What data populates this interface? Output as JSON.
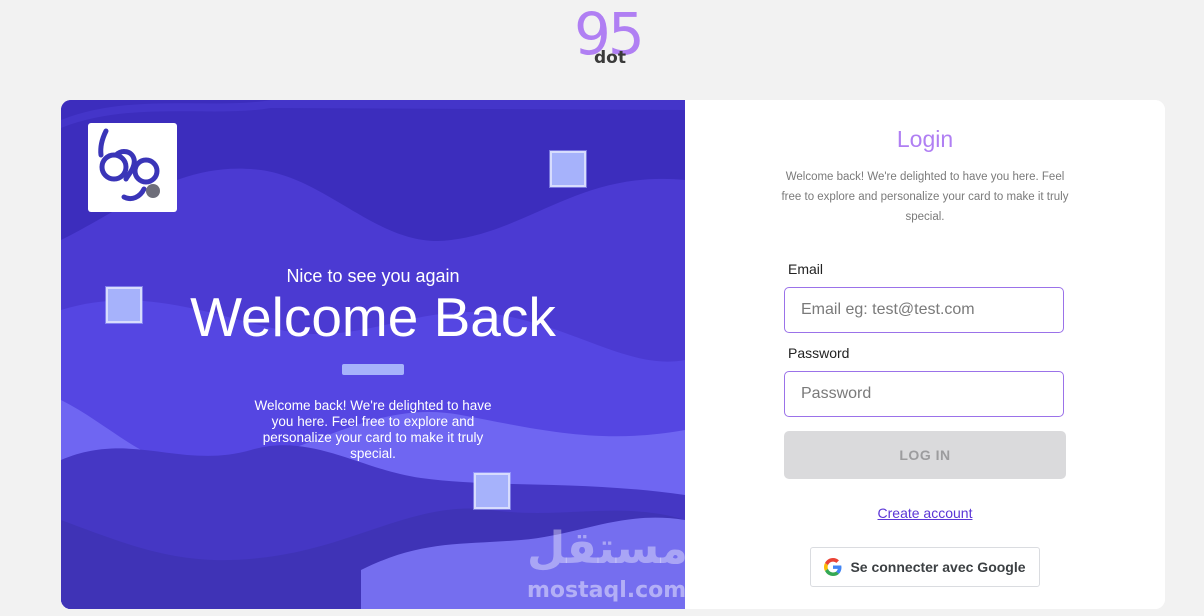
{
  "brand": {
    "number": "95",
    "sub": "dot"
  },
  "hero": {
    "greeting": "Nice to see you again",
    "title": "Welcome Back",
    "description": "Welcome back! We're delighted to have you here. Feel free to explore and personalize your card to make it truly special.",
    "watermark_ar": "مستقل",
    "watermark_en": "mostaql.com",
    "logo_icon": "95dot-logo-icon"
  },
  "login": {
    "title": "Login",
    "description": "Welcome back! We're delighted to have you here. Feel free to explore and personalize your card to make it truly special.",
    "email_label": "Email",
    "email_value": "",
    "email_placeholder": "Email eg: test@test.com",
    "password_label": "Password",
    "password_value": "",
    "password_placeholder": "Password",
    "login_button": "LOG IN",
    "create_account": "Create account",
    "google_button": "Se connecter avec Google",
    "google_icon": "google-g-icon"
  },
  "colors": {
    "accent": "#b07ff3",
    "hero_bg": "#3d2fbf",
    "input_border": "#9b72e9",
    "link": "#5b36d6",
    "button_disabled": "#dadadc"
  }
}
